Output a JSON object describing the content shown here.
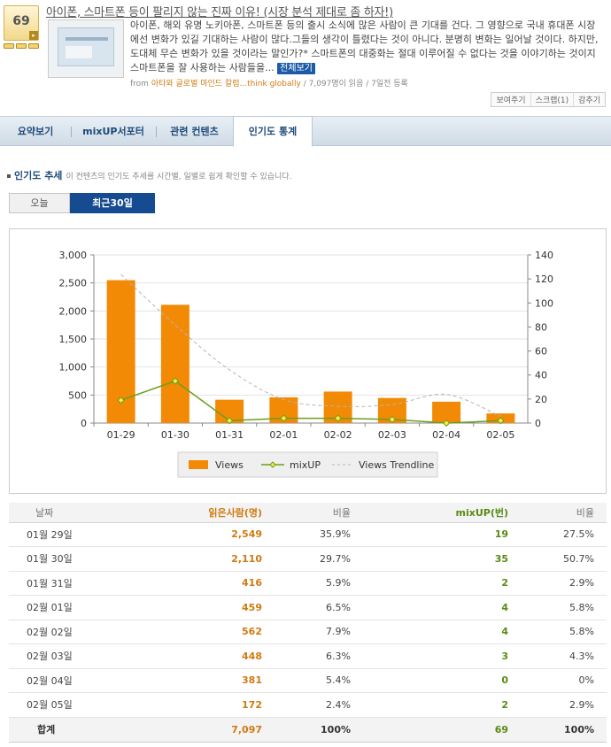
{
  "article": {
    "score": "69",
    "title": "아이폰, 스마트폰 등이 팔리지 않는 진짜 이유! (시장 분석 제대로 좀 하자!)",
    "body": "아이폰, 해외 유명 노키아폰, 스마트폰 등의 출시 소식에 많은 사람이 큰 기대를 건다. 그 영향으로 국내 휴대폰 시장에선 변화가 있길 기대하는 사람이 많다.그들의 생각이 틀렸다는 것이 아니다. 분명히 변화는 일어날 것이다. 하지만, 도대체 무슨 변화가 있을 것이라는 말인가?* 스마트폰의 대중화는 절대 이루어질 수 없다는 것을 이야기하는 것이지 스마트폰을 잘 사용하는 사람들을...",
    "more_label": "전체보기",
    "from_label": "from",
    "source": "아타와 글로벌 마인드 칼럼...think globally",
    "stats": " / 7,097명이 읽음 / 7일전 등록"
  },
  "tools": [
    "보여주기",
    "스크랩(1)",
    "감추기"
  ],
  "tabs": [
    "요약보기",
    "mixUP서포터",
    "관련 컨텐츠",
    "인기도 통계"
  ],
  "section": {
    "title": "인기도 추세",
    "desc": "이 컨텐츠의 인기도 추세를 시간별, 일별로 쉽게 확인할 수 있습니다."
  },
  "period_buttons": {
    "today": "오늘",
    "last30": "최근30일"
  },
  "chart_data": {
    "type": "bar",
    "categories": [
      "01-29",
      "01-30",
      "01-31",
      "02-01",
      "02-02",
      "02-03",
      "02-04",
      "02-05"
    ],
    "series": [
      {
        "name": "Views",
        "type": "bar",
        "axis": "left",
        "values": [
          2549,
          2110,
          416,
          459,
          562,
          448,
          381,
          172
        ]
      },
      {
        "name": "mixUP",
        "type": "line",
        "axis": "right",
        "values": [
          19,
          35,
          2,
          4,
          4,
          3,
          0,
          2
        ]
      },
      {
        "name": "Views Trendline",
        "type": "dashed-line",
        "axis": "left",
        "values": [
          2650,
          1750,
          950,
          420,
          300,
          330,
          510,
          120
        ]
      }
    ],
    "left_axis": {
      "ylim": [
        0,
        3000
      ],
      "ticks": [
        "0",
        "500",
        "1,000",
        "1,500",
        "2,000",
        "2,500",
        "3,000"
      ]
    },
    "right_axis": {
      "ylim": [
        0,
        140
      ],
      "ticks": [
        "0",
        "20",
        "40",
        "60",
        "80",
        "100",
        "120",
        "140"
      ]
    },
    "grid": true,
    "legend": "bottom",
    "colors": {
      "views": "#f28a06",
      "mixup": "#6d9e1d",
      "trend": "#b5b5b5"
    }
  },
  "table": {
    "headers": [
      "날짜",
      "읽은사람(명)",
      "비율",
      "mixUP(번)",
      "비율"
    ],
    "rows": [
      [
        "01월 29일",
        "2,549",
        "35.9%",
        "19",
        "27.5%"
      ],
      [
        "01월 30일",
        "2,110",
        "29.7%",
        "35",
        "50.7%"
      ],
      [
        "01월 31일",
        "416",
        "5.9%",
        "2",
        "2.9%"
      ],
      [
        "02월 01일",
        "459",
        "6.5%",
        "4",
        "5.8%"
      ],
      [
        "02월 02일",
        "562",
        "7.9%",
        "4",
        "5.8%"
      ],
      [
        "02월 03일",
        "448",
        "6.3%",
        "3",
        "4.3%"
      ],
      [
        "02월 04일",
        "381",
        "5.4%",
        "0",
        "0%"
      ],
      [
        "02월 05일",
        "172",
        "2.4%",
        "2",
        "2.9%"
      ]
    ],
    "total": [
      "합계",
      "7,097",
      "100%",
      "69",
      "100%"
    ]
  }
}
